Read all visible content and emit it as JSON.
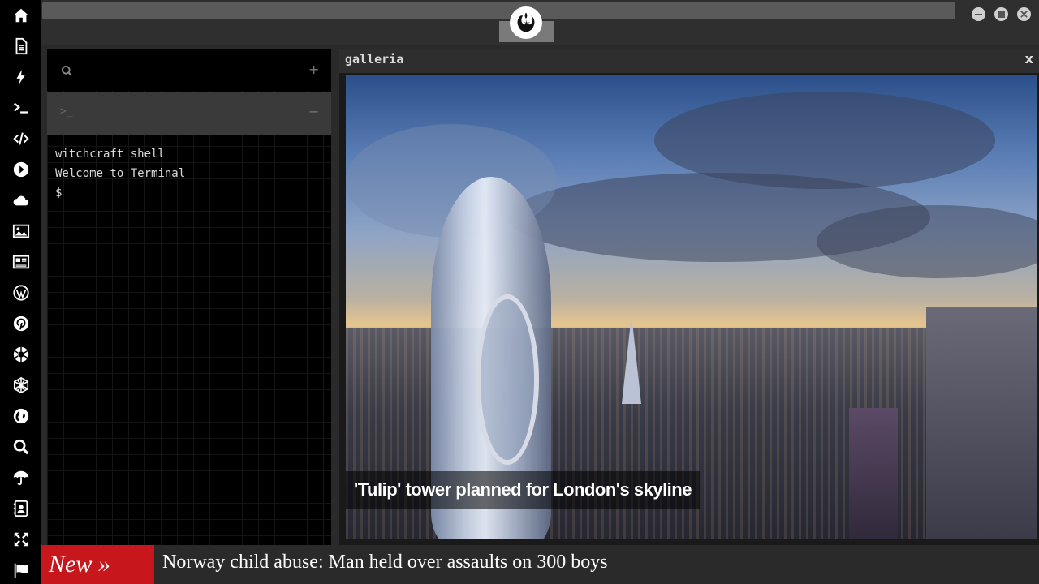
{
  "sidebar": {
    "items": [
      {
        "icon": "home-icon"
      },
      {
        "icon": "document-icon"
      },
      {
        "icon": "lightning-icon"
      },
      {
        "icon": "terminal-icon"
      },
      {
        "icon": "code-icon"
      },
      {
        "icon": "play-icon"
      },
      {
        "icon": "cloud-icon"
      },
      {
        "icon": "image-icon"
      },
      {
        "icon": "newspaper-icon"
      },
      {
        "icon": "wordpress-icon"
      },
      {
        "icon": "pinterest-icon"
      },
      {
        "icon": "aperture-icon"
      },
      {
        "icon": "globe-mesh-icon"
      },
      {
        "icon": "earth-icon"
      },
      {
        "icon": "search-icon"
      },
      {
        "icon": "umbrella-icon"
      },
      {
        "icon": "contacts-icon"
      },
      {
        "icon": "expand-icon"
      },
      {
        "icon": "flag-icon"
      }
    ]
  },
  "window": {
    "logo_icon": "rebel-alliance-icon",
    "controls": [
      "minimize",
      "maximize",
      "close"
    ]
  },
  "terminal": {
    "search_icon": "search-icon",
    "add_label": "+",
    "prompt_symbol": ">_",
    "collapse_label": "−",
    "lines": [
      "witchcraft shell",
      "Welcome to Terminal",
      "$"
    ]
  },
  "gallery": {
    "title": "galleria",
    "close_label": "x",
    "caption": "'Tulip' tower planned for London's skyline"
  },
  "ticker": {
    "label": "New »",
    "headline": "Norway child abuse: Man held over assaults on 300 boys"
  },
  "colors": {
    "ticker_label_bg": "#c8161d",
    "sidebar_bg": "#000000",
    "panel_bg": "#2a2a2a"
  }
}
